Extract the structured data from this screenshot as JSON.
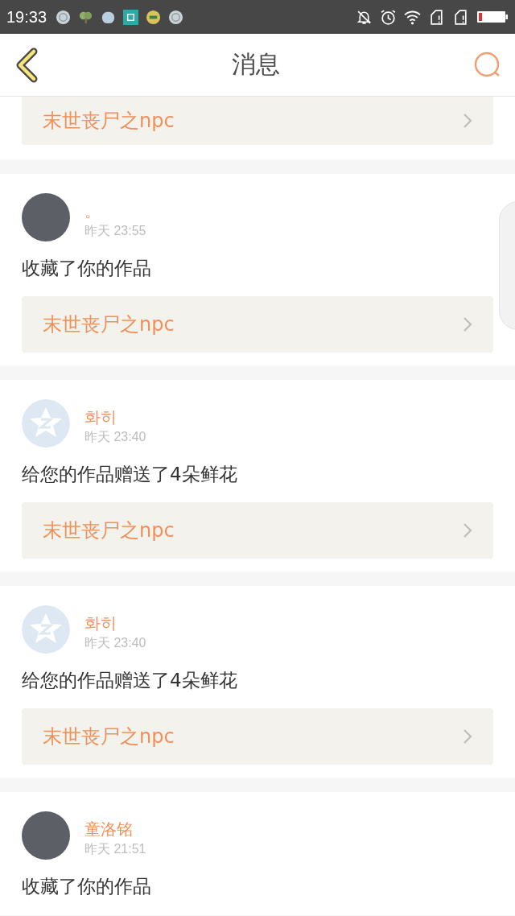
{
  "status_bar": {
    "time": "19:33"
  },
  "header": {
    "title": "消息"
  },
  "messages": [
    {
      "work": "末世丧尸之npc"
    },
    {
      "user": "。",
      "default_avatar": false,
      "time": "昨天 23:55",
      "text": "收藏了你的作品",
      "work": "末世丧尸之npc"
    },
    {
      "user": "화히",
      "default_avatar": true,
      "time": "昨天 23:40",
      "text": "给您的作品赠送了4朵鲜花",
      "work": "末世丧尸之npc"
    },
    {
      "user": "화히",
      "default_avatar": true,
      "time": "昨天 23:40",
      "text": "给您的作品赠送了4朵鲜花",
      "work": "末世丧尸之npc"
    },
    {
      "user": "童洛铭",
      "default_avatar": false,
      "time": "昨天 21:51",
      "text": "收藏了你的作品"
    }
  ]
}
